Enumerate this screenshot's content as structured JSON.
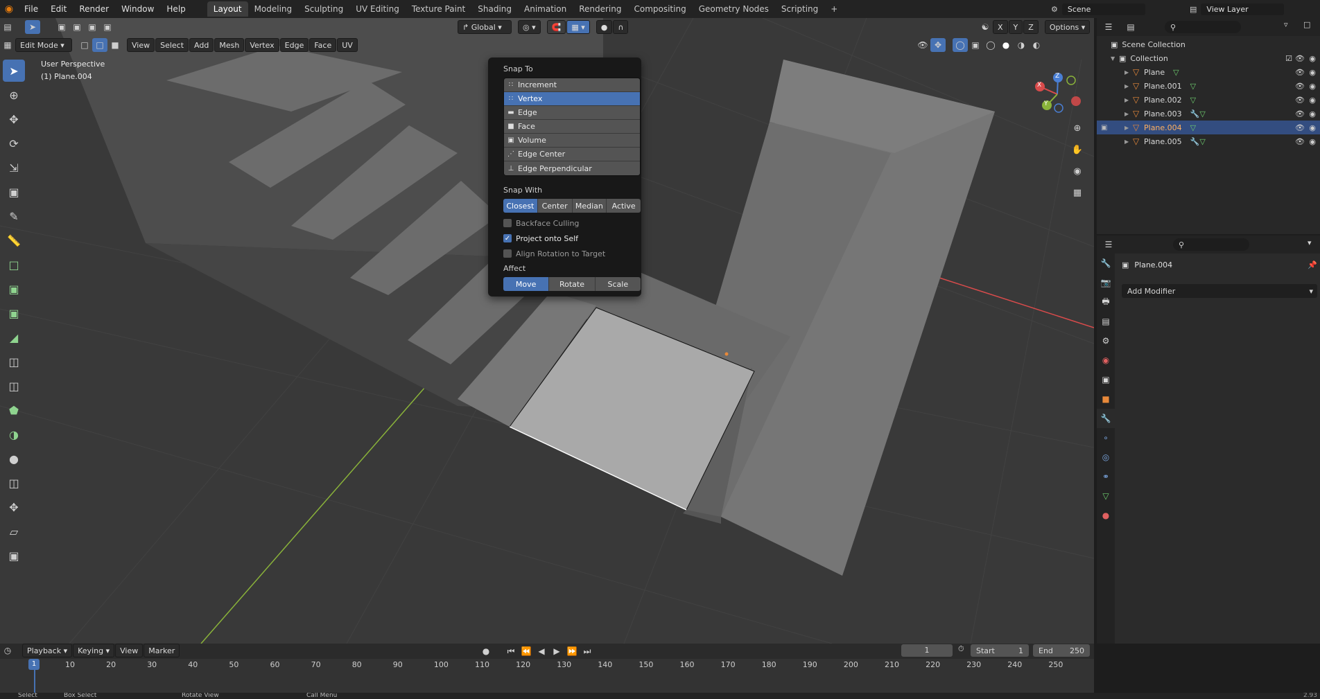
{
  "topbar": {
    "menus": [
      "File",
      "Edit",
      "Render",
      "Window",
      "Help"
    ],
    "workspaces": [
      "Layout",
      "Modeling",
      "Sculpting",
      "UV Editing",
      "Texture Paint",
      "Shading",
      "Animation",
      "Rendering",
      "Compositing",
      "Geometry Nodes",
      "Scripting"
    ],
    "active_workspace": "Layout",
    "scene_name": "Scene",
    "view_layer": "View Layer"
  },
  "viewport": {
    "mode": "Edit Mode",
    "menus": [
      "View",
      "Select",
      "Add",
      "Mesh",
      "Vertex",
      "Edge",
      "Face",
      "UV"
    ],
    "transform_orientation": "Global",
    "options_label": "Options",
    "perspective_label": "User Perspective",
    "object_label": "(1) Plane.004",
    "gizmo": {
      "x": "X",
      "y": "Y",
      "z": "Z"
    },
    "axis_labels": [
      "X",
      "Y",
      "Z"
    ]
  },
  "snap_popup": {
    "snap_to_title": "Snap To",
    "snap_to_items": [
      {
        "label": "Increment",
        "icon": "increment-icon",
        "selected": false
      },
      {
        "label": "Vertex",
        "icon": "vertex-icon",
        "selected": true
      },
      {
        "label": "Edge",
        "icon": "edge-icon",
        "selected": false
      },
      {
        "label": "Face",
        "icon": "face-icon",
        "selected": false
      },
      {
        "label": "Volume",
        "icon": "volume-icon",
        "selected": false
      },
      {
        "label": "Edge Center",
        "icon": "edge-center-icon",
        "selected": false
      },
      {
        "label": "Edge Perpendicular",
        "icon": "edge-perpendicular-icon",
        "selected": false
      }
    ],
    "snap_with_title": "Snap With",
    "snap_with": [
      "Closest",
      "Center",
      "Median",
      "Active"
    ],
    "snap_with_active": "Closest",
    "backface_culling": "Backface Culling",
    "project_onto_self": "Project onto Self",
    "align_rotation": "Align Rotation to Target",
    "affect_title": "Affect",
    "affect": [
      "Move",
      "Rotate",
      "Scale"
    ],
    "affect_active": "Move"
  },
  "outliner": {
    "scene_collection": "Scene Collection",
    "collection": "Collection",
    "objects": [
      {
        "name": "Plane",
        "selected": false,
        "modifier": false
      },
      {
        "name": "Plane.001",
        "selected": false,
        "modifier": false
      },
      {
        "name": "Plane.002",
        "selected": false,
        "modifier": false
      },
      {
        "name": "Plane.003",
        "selected": false,
        "modifier": true
      },
      {
        "name": "Plane.004",
        "selected": true,
        "modifier": false
      },
      {
        "name": "Plane.005",
        "selected": false,
        "modifier": true
      }
    ]
  },
  "properties": {
    "object_name": "Plane.004",
    "add_modifier": "Add Modifier"
  },
  "timeline": {
    "menus": [
      "Playback",
      "Keying",
      "View",
      "Marker"
    ],
    "current_frame": "1",
    "start_label": "Start",
    "start": "1",
    "end_label": "End",
    "end": "250",
    "ruler": [
      "10",
      "20",
      "30",
      "40",
      "50",
      "60",
      "70",
      "80",
      "90",
      "100",
      "110",
      "120",
      "130",
      "140",
      "150",
      "160",
      "170",
      "180",
      "190",
      "200",
      "210",
      "220",
      "230",
      "240",
      "250"
    ],
    "playhead": "1"
  },
  "statusbar": {
    "items": [
      "Select",
      "Box Select",
      "Rotate View",
      "Call Menu"
    ],
    "version": "2.93"
  },
  "colors": {
    "accent": "#4772b3",
    "x_axis": "#d94b4b",
    "y_axis": "#8ab33a",
    "object_orange": "#e8893a"
  }
}
